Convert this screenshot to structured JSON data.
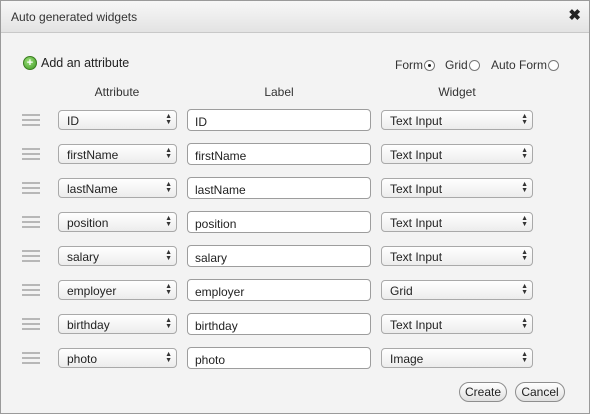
{
  "dialog": {
    "title": "Auto generated widgets"
  },
  "toolbar": {
    "add_label": "Add an attribute"
  },
  "layout_options": [
    {
      "label": "Form",
      "checked": true
    },
    {
      "label": "Grid",
      "checked": false
    },
    {
      "label": "Auto Form",
      "checked": false
    }
  ],
  "columns": {
    "attribute": "Attribute",
    "label": "Label",
    "widget": "Widget"
  },
  "rows": [
    {
      "attribute": "ID",
      "label": "ID",
      "widget": "Text Input"
    },
    {
      "attribute": "firstName",
      "label": "firstName",
      "widget": "Text Input"
    },
    {
      "attribute": "lastName",
      "label": "lastName",
      "widget": "Text Input"
    },
    {
      "attribute": "position",
      "label": "position",
      "widget": "Text Input"
    },
    {
      "attribute": "salary",
      "label": "salary",
      "widget": "Text Input"
    },
    {
      "attribute": "employer",
      "label": "employer",
      "widget": "Grid"
    },
    {
      "attribute": "birthday",
      "label": "birthday",
      "widget": "Text Input"
    },
    {
      "attribute": "photo",
      "label": "photo",
      "widget": "Image"
    }
  ],
  "buttons": {
    "create": "Create",
    "cancel": "Cancel"
  },
  "icons": {
    "close": "close-icon",
    "add": "add-circle-icon",
    "drag": "drag-handle-icon",
    "select_arrows": "updown-arrows-icon"
  },
  "colors": {
    "add_icon": "#4caf2a",
    "background": "#f3f3f3"
  }
}
